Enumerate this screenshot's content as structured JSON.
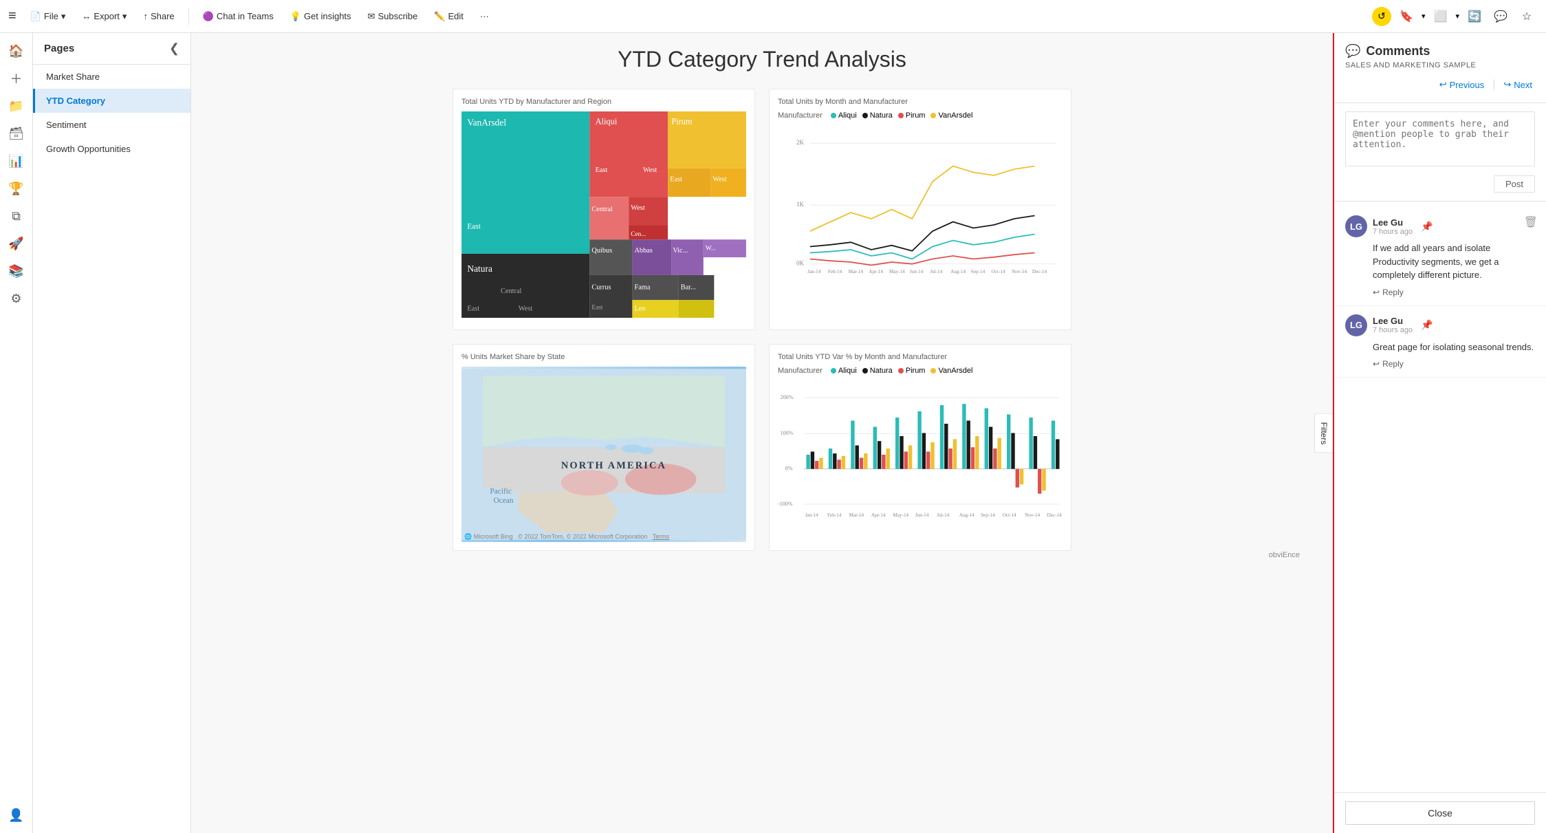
{
  "toolbar": {
    "hamburger": "≡",
    "file_label": "File",
    "export_label": "Export",
    "share_label": "Share",
    "chat_label": "Chat in Teams",
    "insights_label": "Get insights",
    "subscribe_label": "Subscribe",
    "edit_label": "Edit",
    "more_label": "···"
  },
  "pages": {
    "title": "Pages",
    "items": [
      {
        "label": "Market Share",
        "active": false
      },
      {
        "label": "YTD Category",
        "active": true
      },
      {
        "label": "Sentiment",
        "active": false
      },
      {
        "label": "Growth Opportunities",
        "active": false
      }
    ]
  },
  "report": {
    "title": "YTD Category Trend Analysis",
    "treemap_title": "Total Units YTD by Manufacturer and Region",
    "linechart_title": "Total Units by Month and Manufacturer",
    "map_title": "% Units Market Share by State",
    "barchart_title": "Total Units YTD Var % by Month and Manufacturer",
    "map_label": "NORTH AMERICA",
    "map_sub": "Pacific\nOcean",
    "map_watermark": "Microsoft Bing   © 2022 TomTom, © 2022 Microsoft Corporation  Terms",
    "obvi_watermark": "obviEnce",
    "manufacturer_label": "Manufacturer",
    "legend": {
      "aliquo_color": "#2bbcb8",
      "natura_color": "#1a1a1a",
      "pirum_color": "#e05050",
      "vanarsdel_color": "#f0c030"
    },
    "y_axis_labels": [
      "2K",
      "1K",
      "0K"
    ],
    "x_axis_labels": [
      "Jan-14",
      "Feb-14",
      "Mar-14",
      "Apr-14",
      "May-14",
      "Jun-14",
      "Jul-14",
      "Aug-14",
      "Sep-14",
      "Oct-14",
      "Nov-14",
      "Dec-14"
    ],
    "bar_y_labels": [
      "200%",
      "100%",
      "0%",
      "-100%"
    ],
    "filters_label": "Filters"
  },
  "comments": {
    "title": "Comments",
    "subtitle": "SALES AND MARKETING SAMPLE",
    "previous_label": "Previous",
    "next_label": "Next",
    "input_placeholder": "Enter your comments here, and @mention people to grab their attention.",
    "post_label": "Post",
    "items": [
      {
        "author": "Lee Gu",
        "avatar_initials": "LG",
        "time": "7 hours ago",
        "body": "If we add all years and isolate Productivity segments, we get a completely different picture.",
        "reply_label": "Reply"
      },
      {
        "author": "Lee Gu",
        "avatar_initials": "LG",
        "time": "7 hours ago",
        "body": "Great page for isolating seasonal trends.",
        "reply_label": "Reply"
      }
    ],
    "close_label": "Close"
  }
}
